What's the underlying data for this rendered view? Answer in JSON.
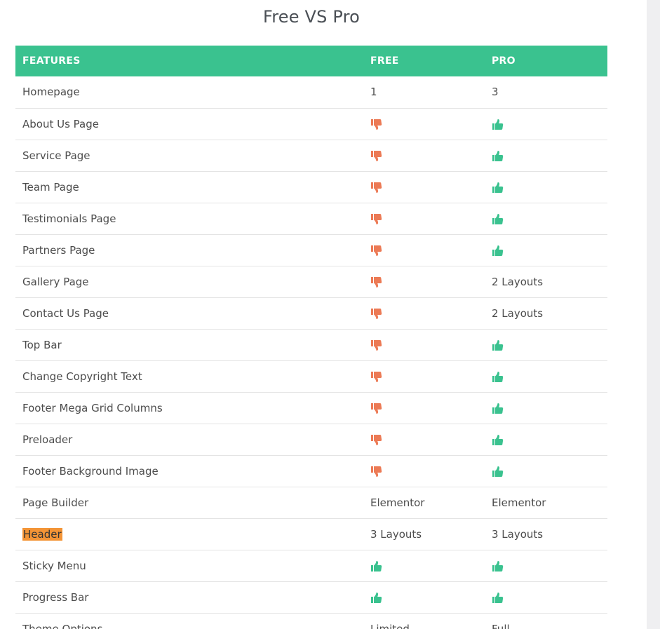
{
  "page": {
    "title": "Free VS Pro"
  },
  "colors": {
    "header_bg": "#3ac28f",
    "thumbs_up": "#3ac28f",
    "thumbs_down": "#ec7a55",
    "highlight": "#f39436"
  },
  "table": {
    "headers": {
      "features": "FEATURES",
      "free": "FREE",
      "pro": "PRO"
    },
    "rows": [
      {
        "feature": "Homepage",
        "free": {
          "type": "text",
          "value": "1"
        },
        "pro": {
          "type": "text",
          "value": "3"
        }
      },
      {
        "feature": "About Us Page",
        "free": {
          "type": "icon",
          "value": "thumbs-down-icon"
        },
        "pro": {
          "type": "icon",
          "value": "thumbs-up-icon"
        }
      },
      {
        "feature": "Service Page",
        "free": {
          "type": "icon",
          "value": "thumbs-down-icon"
        },
        "pro": {
          "type": "icon",
          "value": "thumbs-up-icon"
        }
      },
      {
        "feature": "Team Page",
        "free": {
          "type": "icon",
          "value": "thumbs-down-icon"
        },
        "pro": {
          "type": "icon",
          "value": "thumbs-up-icon"
        }
      },
      {
        "feature": "Testimonials Page",
        "free": {
          "type": "icon",
          "value": "thumbs-down-icon"
        },
        "pro": {
          "type": "icon",
          "value": "thumbs-up-icon"
        }
      },
      {
        "feature": "Partners Page",
        "free": {
          "type": "icon",
          "value": "thumbs-down-icon"
        },
        "pro": {
          "type": "icon",
          "value": "thumbs-up-icon"
        }
      },
      {
        "feature": "Gallery Page",
        "free": {
          "type": "icon",
          "value": "thumbs-down-icon"
        },
        "pro": {
          "type": "text",
          "value": "2 Layouts"
        }
      },
      {
        "feature": "Contact Us Page",
        "free": {
          "type": "icon",
          "value": "thumbs-down-icon"
        },
        "pro": {
          "type": "text",
          "value": "2 Layouts"
        }
      },
      {
        "feature": "Top Bar",
        "free": {
          "type": "icon",
          "value": "thumbs-down-icon"
        },
        "pro": {
          "type": "icon",
          "value": "thumbs-up-icon"
        }
      },
      {
        "feature": "Change Copyright Text",
        "free": {
          "type": "icon",
          "value": "thumbs-down-icon"
        },
        "pro": {
          "type": "icon",
          "value": "thumbs-up-icon"
        }
      },
      {
        "feature": "Footer Mega Grid Columns",
        "free": {
          "type": "icon",
          "value": "thumbs-down-icon"
        },
        "pro": {
          "type": "icon",
          "value": "thumbs-up-icon"
        }
      },
      {
        "feature": "Preloader",
        "free": {
          "type": "icon",
          "value": "thumbs-down-icon"
        },
        "pro": {
          "type": "icon",
          "value": "thumbs-up-icon"
        }
      },
      {
        "feature": "Footer Background Image",
        "free": {
          "type": "icon",
          "value": "thumbs-down-icon"
        },
        "pro": {
          "type": "icon",
          "value": "thumbs-up-icon"
        }
      },
      {
        "feature": "Page Builder",
        "free": {
          "type": "text",
          "value": "Elementor"
        },
        "pro": {
          "type": "text",
          "value": "Elementor"
        }
      },
      {
        "feature": "Header",
        "highlight": true,
        "free": {
          "type": "text",
          "value": "3 Layouts"
        },
        "pro": {
          "type": "text",
          "value": "3 Layouts"
        }
      },
      {
        "feature": "Sticky Menu",
        "free": {
          "type": "icon",
          "value": "thumbs-up-icon"
        },
        "pro": {
          "type": "icon",
          "value": "thumbs-up-icon"
        }
      },
      {
        "feature": "Progress Bar",
        "free": {
          "type": "icon",
          "value": "thumbs-up-icon"
        },
        "pro": {
          "type": "icon",
          "value": "thumbs-up-icon"
        }
      },
      {
        "feature": "Theme Options",
        "free": {
          "type": "text",
          "value": "Limited"
        },
        "pro": {
          "type": "text",
          "value": "Full"
        }
      }
    ]
  }
}
